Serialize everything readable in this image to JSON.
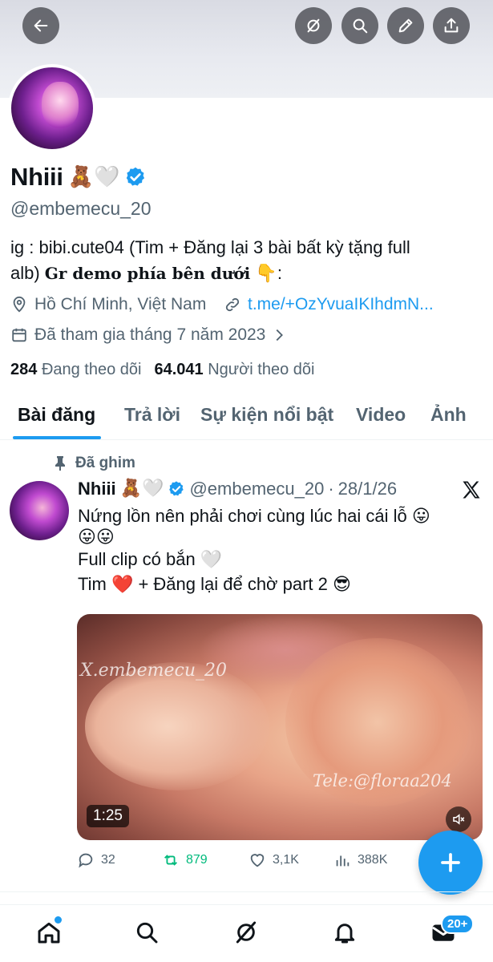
{
  "profile": {
    "name": "Nhiii",
    "name_emojis": "🧸🤍",
    "handle": "@embemecu_20",
    "bio_line1": "ig : bibi.cute04 (Tim + Đăng lại 3 bài bất kỳ tặng full",
    "bio_line2_plain": "alb) ",
    "bio_line2_styled": "Gr demo phía bên dưới",
    "bio_line2_emoji": "👇",
    "bio_line2_end": ":",
    "location": "Hồ Chí Minh, Việt Nam",
    "link": "t.me/+OzYvuaIKIhdmN...",
    "joined": "Đã tham gia tháng 7 năm 2023",
    "following_count": "284",
    "following_label": "Đang theo dõi",
    "followers_count": "64.041",
    "followers_label": "Người theo dõi"
  },
  "tabs": [
    {
      "label": "Bài đăng",
      "active": true
    },
    {
      "label": "Trả lời",
      "active": false
    },
    {
      "label": "Sự kiện nổi bật",
      "active": false
    },
    {
      "label": "Video",
      "active": false
    },
    {
      "label": "Ảnh",
      "active": false
    }
  ],
  "post": {
    "pinned_label": "Đã ghim",
    "name": "Nhiii",
    "name_emojis": "🧸🤍",
    "handle": "@embemecu_20",
    "separator": "·",
    "date": "28/1/26",
    "line1": "Nứng lồn nên phải chơi cùng lúc hai cái lỗ 😛",
    "line2": "😛😛",
    "line3": "Full clip có bắn 🤍",
    "line4": "Tim ❤️ + Đăng lại để chờ part 2 😎",
    "video_duration": "1:25",
    "watermark1": "X.embemecu_20",
    "watermark2": "Tele:@floraa204",
    "replies": "32",
    "reposts": "879",
    "likes": "3,1K",
    "views": "388K"
  },
  "nav": {
    "messages_badge": "20+"
  },
  "colors": {
    "accent": "#1d9bf0",
    "repost": "#00ba7c",
    "secondary_text": "#536471"
  }
}
